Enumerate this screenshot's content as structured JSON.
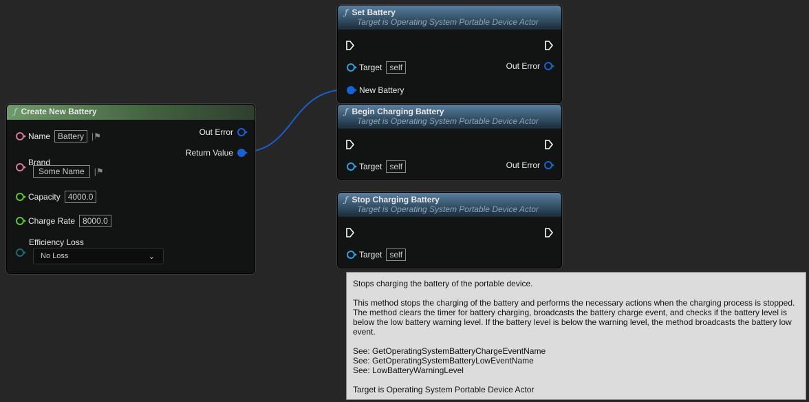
{
  "create_node": {
    "title": "Create New Battery",
    "pins": {
      "name": {
        "label": "Name",
        "value": "Battery"
      },
      "brand": {
        "label": "Brand",
        "value": "Some Name"
      },
      "capacity": {
        "label": "Capacity",
        "value": "4000.0"
      },
      "charge_rate": {
        "label": "Charge Rate",
        "value": "8000.0"
      },
      "efficiency_loss": {
        "label": "Efficiency Loss",
        "value": "No Loss"
      },
      "out_error": "Out Error",
      "return_value": "Return Value"
    }
  },
  "set_node": {
    "title": "Set Battery",
    "subtitle": "Target is Operating System Portable Device Actor",
    "target_label": "Target",
    "target_value": "self",
    "out_error": "Out Error",
    "new_battery": "New Battery"
  },
  "begin_node": {
    "title": "Begin Charging Battery",
    "subtitle": "Target is Operating System Portable Device Actor",
    "target_label": "Target",
    "target_value": "self",
    "out_error": "Out Error"
  },
  "stop_node": {
    "title": "Stop Charging Battery",
    "subtitle": "Target is Operating System Portable Device Actor",
    "target_label": "Target",
    "target_value": "self"
  },
  "tooltip": {
    "summary": "Stops charging the battery of the portable device.",
    "body": "This method stops the charging of the battery and performs the necessary actions when the charging process is stopped. The method clears the timer for battery charging, broadcasts the battery charge event, and checks if the battery level is below the low battery warning level. If the battery level is below the warning level, the method broadcasts the battery low event.",
    "see": [
      "See: GetOperatingSystemBatteryChargeEventName",
      "See: GetOperatingSystemBatteryLowEventName",
      "See: LowBatteryWarningLevel"
    ],
    "target": "Target is Operating System Portable Device Actor"
  },
  "colors": {
    "string_pin": "#d67a9c",
    "float_pin": "#5ac82a",
    "enum_pin": "#1d6b6b",
    "object_pin": "#2ea1e0",
    "struct_pin": "#1b60d6",
    "wire": "#1b5fc8"
  }
}
